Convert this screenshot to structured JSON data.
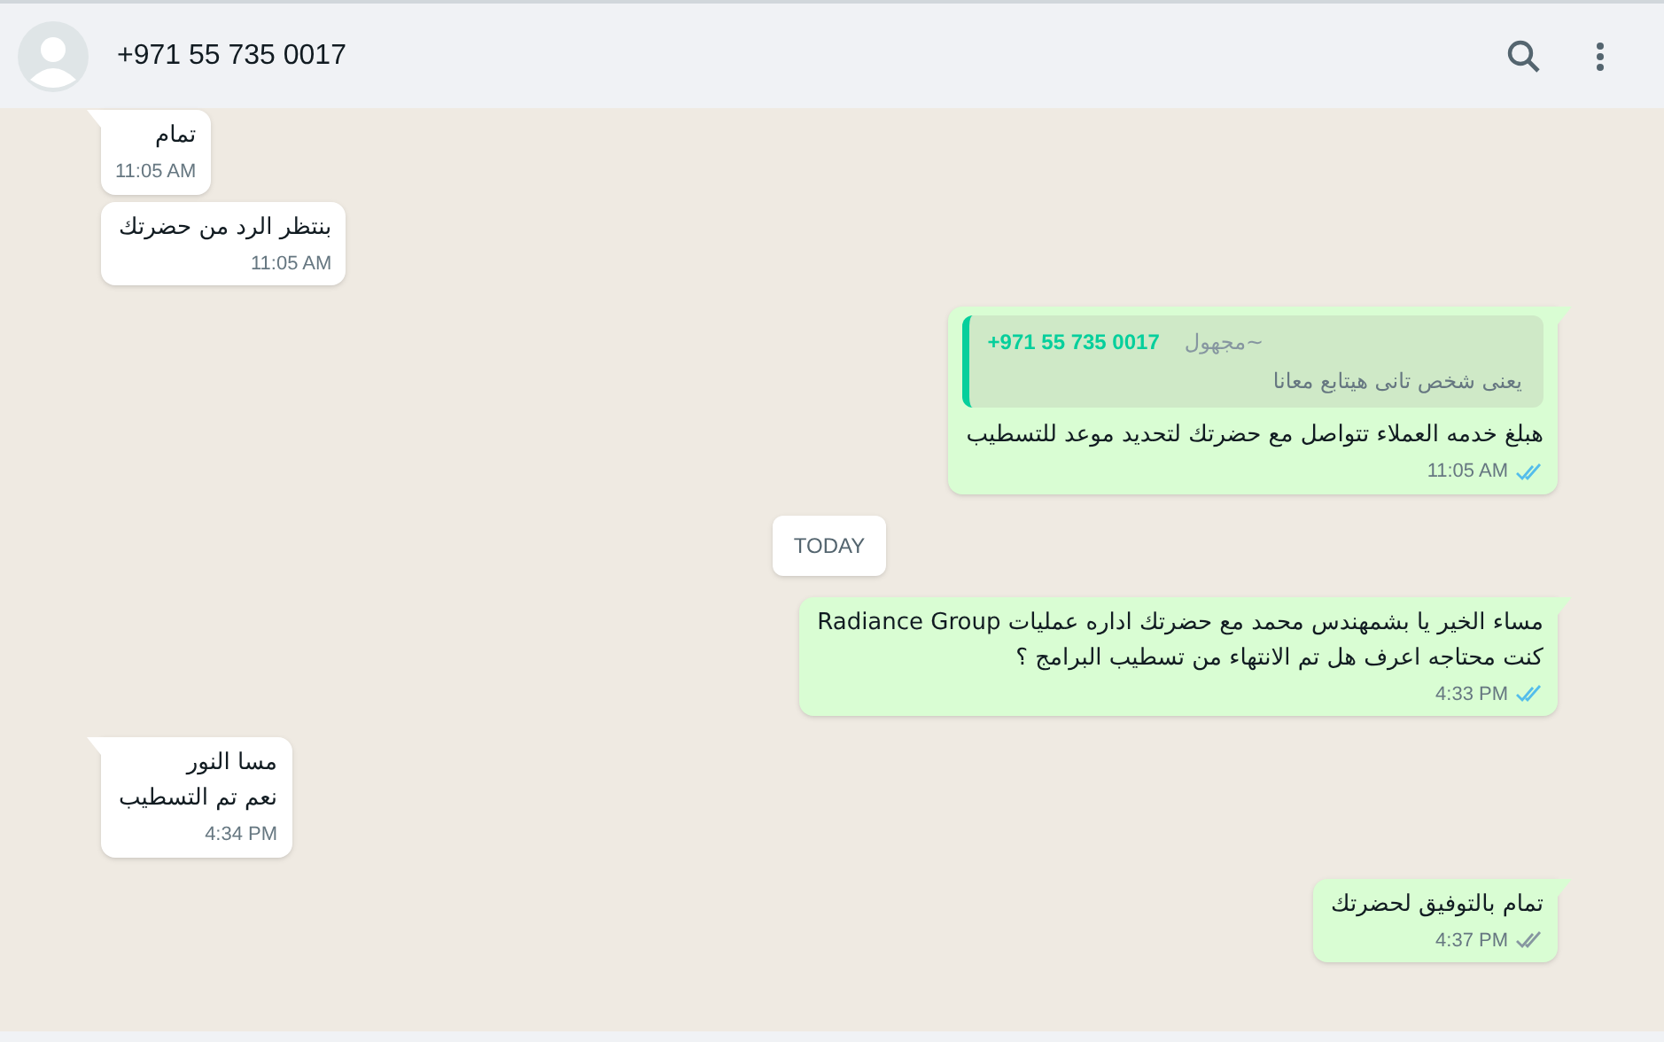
{
  "header": {
    "contact": "+971 55 735 0017"
  },
  "messages": [
    {
      "kind": "message",
      "outgoing": false,
      "lines": [
        "تمام"
      ],
      "time": "11:05 AM"
    },
    {
      "kind": "message",
      "outgoing": false,
      "lines": [
        "بنتظر الرد من حضرتك"
      ],
      "time": "11:05 AM"
    },
    {
      "kind": "message",
      "outgoing": true,
      "quote": {
        "author": "~مجهول",
        "phone": "+971 55 735 0017",
        "text": "يعنى شخص تانى هيتابع معانا"
      },
      "lines": [
        "هبلغ خدمه العملاء تتواصل مع حضرتك لتحديد موعد للتسطيب"
      ],
      "time": "11:05 AM",
      "read": true
    },
    {
      "kind": "date",
      "text": "TODAY"
    },
    {
      "kind": "message",
      "outgoing": true,
      "lines": [
        "مساء الخير يا بشمهندس محمد مع حضرتك اداره عمليات Radiance Group",
        "كنت محتاجه اعرف هل تم الانتهاء من تسطيب البرامج ؟"
      ],
      "time": "4:33 PM",
      "read": true
    },
    {
      "kind": "message",
      "outgoing": false,
      "lines": [
        "مسا النور",
        "نعم تم التسطيب"
      ],
      "time": "4:34 PM"
    },
    {
      "kind": "message",
      "outgoing": true,
      "lines": [
        "تمام بالتوفيق لحضرتك"
      ],
      "time": "4:37 PM",
      "read": false
    }
  ]
}
